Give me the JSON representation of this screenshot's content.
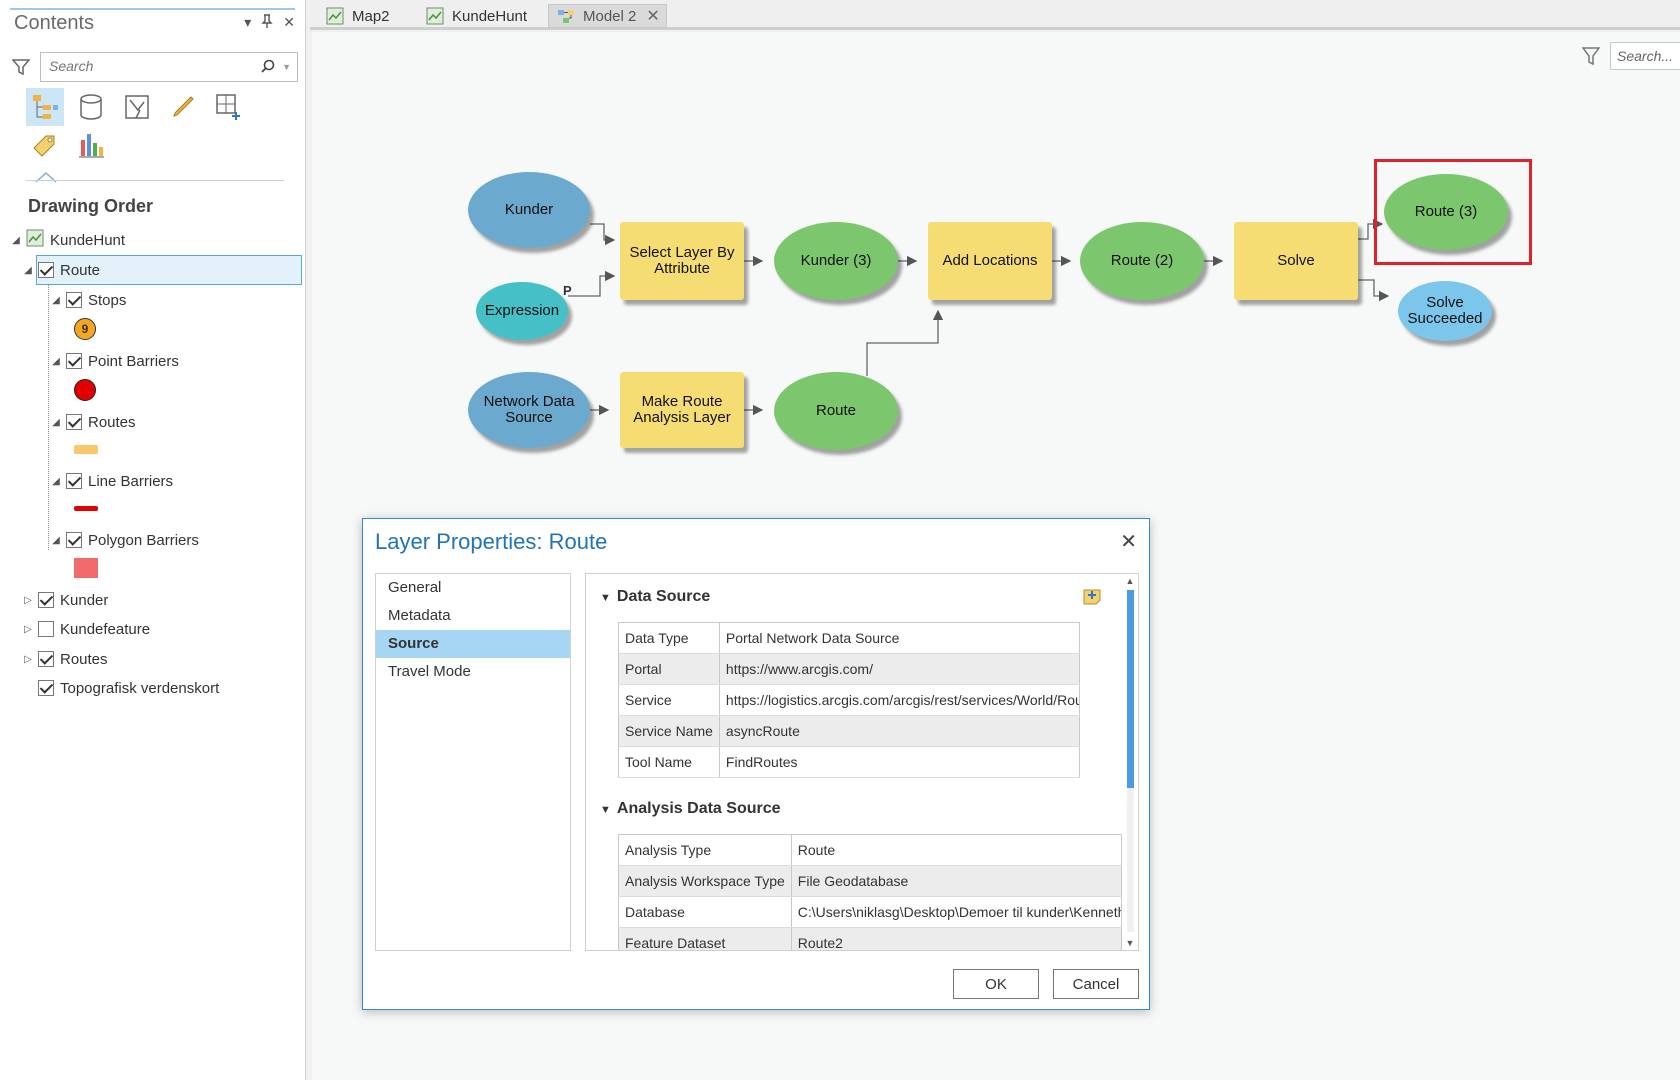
{
  "contents": {
    "title": "Contents",
    "search_placeholder": "Search",
    "section_label": "Drawing Order",
    "map_name": "KundeHunt",
    "layers": {
      "route": "Route",
      "stops": "Stops",
      "stops_badge": "9",
      "point_barriers": "Point Barriers",
      "routes_sub": "Routes",
      "line_barriers": "Line Barriers",
      "polygon_barriers": "Polygon Barriers",
      "kunder": "Kunder",
      "kundefeature": "Kundefeature",
      "routes": "Routes",
      "topo": "Topografisk verdenskort"
    },
    "colors": {
      "stops": "#f5a623",
      "point_barriers": "#e30000",
      "routes": "#f8c86a",
      "line_barriers": "#e30000",
      "polygon_barriers": "#f26b6b"
    }
  },
  "tabs": [
    {
      "label": "Map2",
      "icon": "map-icon",
      "active": false
    },
    {
      "label": "KundeHunt",
      "icon": "map-icon",
      "active": false
    },
    {
      "label": "Model 2",
      "icon": "model-icon",
      "active": true
    }
  ],
  "canvas": {
    "search_placeholder": "Search...",
    "nodes": {
      "kunder": "Kunder",
      "expression": "Expression",
      "expression_tag": "P",
      "select_layer": "Select Layer By Attribute",
      "kunder3": "Kunder (3)",
      "add_locations": "Add Locations",
      "route2": "Route (2)",
      "solve": "Solve",
      "route3": "Route (3)",
      "solve_succeeded": "Solve Succeeded",
      "network_source": "Network Data Source",
      "make_route": "Make Route Analysis Layer",
      "route": "Route"
    }
  },
  "dialog": {
    "title": "Layer Properties: Route",
    "nav": [
      "General",
      "Metadata",
      "Source",
      "Travel Mode"
    ],
    "selected_nav": "Source",
    "data_source": {
      "title": "Data Source",
      "rows": [
        {
          "key": "Data Type",
          "value": "Portal Network Data Source"
        },
        {
          "key": "Portal",
          "value": "https://www.arcgis.com/"
        },
        {
          "key": "Service",
          "value": "https://logistics.arcgis.com/arcgis/rest/services/World/Rout"
        },
        {
          "key": "Service Name",
          "value": "asyncRoute"
        },
        {
          "key": "Tool Name",
          "value": "FindRoutes"
        }
      ]
    },
    "analysis_source": {
      "title": "Analysis Data Source",
      "rows": [
        {
          "key": "Analysis Type",
          "value": "Route"
        },
        {
          "key": "Analysis Workspace Type",
          "value": "File Geodatabase"
        },
        {
          "key": "Database",
          "value": "C:\\Users\\niklasg\\Desktop\\Demoer til kunder\\Kenneths"
        },
        {
          "key": "Feature Dataset",
          "value": "Route2"
        }
      ]
    },
    "ok_label": "OK",
    "cancel_label": "Cancel"
  }
}
